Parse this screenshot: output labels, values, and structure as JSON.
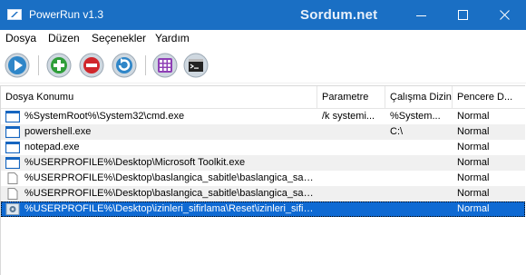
{
  "window": {
    "title": "PowerRun v1.3",
    "watermark": "Sordum.net",
    "accent": "#1a6fc4"
  },
  "menu": {
    "items": [
      "Dosya",
      "Düzen",
      "Seçenekler",
      "Yardım"
    ]
  },
  "toolbar": {
    "buttons": [
      {
        "name": "run-icon",
        "color": "#2f86c8"
      },
      {
        "name": "add-icon",
        "color": "#2f9e3a"
      },
      {
        "name": "remove-icon",
        "color": "#d0262b"
      },
      {
        "name": "refresh-icon",
        "color": "#2f86c8"
      },
      {
        "name": "grid-icon",
        "color": "#8e3fb5"
      },
      {
        "name": "cmd-icon",
        "color": "#333333"
      }
    ]
  },
  "list": {
    "columns": [
      "Dosya Konumu",
      "Parametre",
      "Çalışma Dizini",
      "Pencere D..."
    ],
    "rows": [
      {
        "path": "%SystemRoot%\\System32\\cmd.exe",
        "param": "/k systemi...",
        "workdir": "%System...",
        "window": "Normal",
        "icon": "window-icon"
      },
      {
        "path": "powershell.exe",
        "param": "",
        "workdir": "C:\\",
        "window": "Normal",
        "icon": "window-icon"
      },
      {
        "path": "notepad.exe",
        "param": "",
        "workdir": "",
        "window": "Normal",
        "icon": "window-icon"
      },
      {
        "path": "%USERPROFILE%\\Desktop\\Microsoft Toolkit.exe",
        "param": "",
        "workdir": "",
        "window": "Normal",
        "icon": "window-icon"
      },
      {
        "path": "%USERPROFILE%\\Desktop\\baslangica_sabitle\\baslangica_sabitl...",
        "param": "",
        "workdir": "",
        "window": "Normal",
        "icon": "file-icon"
      },
      {
        "path": "%USERPROFILE%\\Desktop\\baslangica_sabitle\\baslangica_sabitl...",
        "param": "",
        "workdir": "",
        "window": "Normal",
        "icon": "file-icon"
      },
      {
        "path": "%USERPROFILE%\\Desktop\\izinleri_sifirlama\\Reset\\izinleri_sifirla...",
        "param": "",
        "workdir": "",
        "window": "Normal",
        "icon": "gear-file-icon",
        "selected": true
      }
    ]
  }
}
